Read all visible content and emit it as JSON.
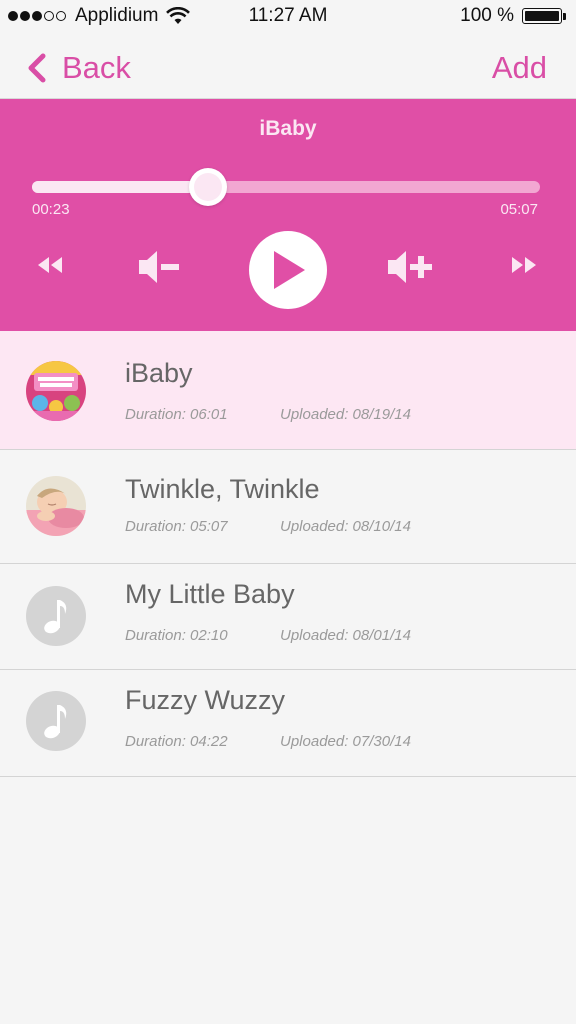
{
  "status_bar": {
    "carrier": "Applidium",
    "time": "11:27 AM",
    "battery": "100 %"
  },
  "nav": {
    "back_label": "Back",
    "add_label": "Add"
  },
  "colors": {
    "accent": "#d94ea6",
    "player_bg": "#e04fa6",
    "active_row": "#fde7f3"
  },
  "player": {
    "title": "iBaby",
    "elapsed": "00:23",
    "total": "05:07",
    "progress_fraction": 0.346,
    "controls": [
      "rewind-icon",
      "volume-down-icon",
      "play-icon",
      "volume-up-icon",
      "fast-forward-icon"
    ]
  },
  "tracks": [
    {
      "title": "iBaby",
      "duration": "Duration: 06:01",
      "uploaded": "Uploaded: 08/19/14",
      "thumb": "baby-songs-album-art",
      "active": true
    },
    {
      "title": "Twinkle, Twinkle",
      "duration": "Duration: 05:07",
      "uploaded": "Uploaded: 08/10/14",
      "thumb": "sleeping-baby-photo",
      "active": false
    },
    {
      "title": "My Little Baby",
      "duration": "Duration: 02:10",
      "uploaded": "Uploaded: 08/01/14",
      "thumb": "music-note-icon",
      "active": false
    },
    {
      "title": "Fuzzy Wuzzy",
      "duration": "Duration: 04:22",
      "uploaded": "Uploaded: 07/30/14",
      "thumb": "music-note-icon",
      "active": false
    }
  ]
}
